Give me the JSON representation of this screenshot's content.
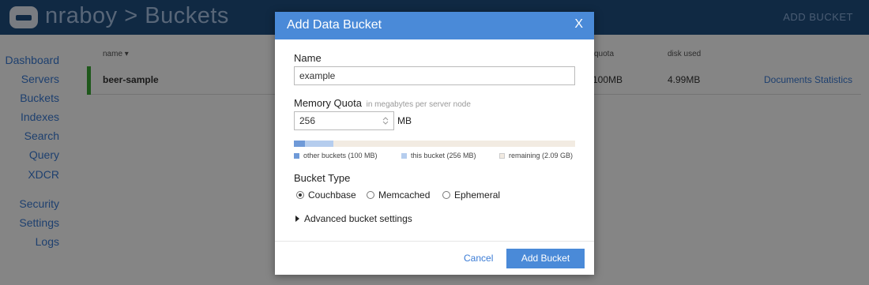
{
  "header": {
    "title": "nraboy > Buckets",
    "add_bucket_link": "ADD BUCKET"
  },
  "sidebar": {
    "items": [
      {
        "label": "Dashboard"
      },
      {
        "label": "Servers"
      },
      {
        "label": "Buckets"
      },
      {
        "label": "Indexes"
      },
      {
        "label": "Search"
      },
      {
        "label": "Query"
      },
      {
        "label": "XDCR"
      },
      {
        "label": "Security"
      },
      {
        "label": "Settings"
      },
      {
        "label": "Logs"
      }
    ]
  },
  "table": {
    "columns": [
      "name",
      "quota",
      "disk used"
    ],
    "sort_indicator": "▾",
    "rows": [
      {
        "name": "beer-sample",
        "quota": "100MB",
        "disk_used": "4.99MB",
        "links": [
          "Documents",
          "Statistics"
        ]
      }
    ]
  },
  "modal": {
    "title": "Add Data Bucket",
    "close": "X",
    "name_label": "Name",
    "name_value": "example",
    "quota_label": "Memory Quota",
    "quota_hint": "in megabytes per server node",
    "quota_value": "256",
    "quota_unit": "MB",
    "usage": {
      "other_fraction": 0.04,
      "this_fraction": 0.1,
      "colors": {
        "other": "#6f9ad8",
        "this": "#b5cdee",
        "remaining": "#f2ebe2"
      },
      "legend": [
        "other buckets (100 MB)",
        "this bucket (256 MB)",
        "remaining (2.09 GB)"
      ]
    },
    "bucket_type_label": "Bucket Type",
    "bucket_types": [
      {
        "label": "Couchbase",
        "selected": true
      },
      {
        "label": "Memcached",
        "selected": false
      },
      {
        "label": "Ephemeral",
        "selected": false
      }
    ],
    "advanced_label": "Advanced bucket settings",
    "cancel_label": "Cancel",
    "submit_label": "Add Bucket"
  },
  "colors": {
    "header_bg": "#1f4f81",
    "modal_header_bg": "#4a8ad8",
    "link": "#3a7bd5",
    "row_status": "#3aaa35"
  },
  "icons": {
    "logo": "couchbase-logo-icon",
    "spinner": "number-spinner-icon",
    "caret": "caret-right-icon"
  }
}
